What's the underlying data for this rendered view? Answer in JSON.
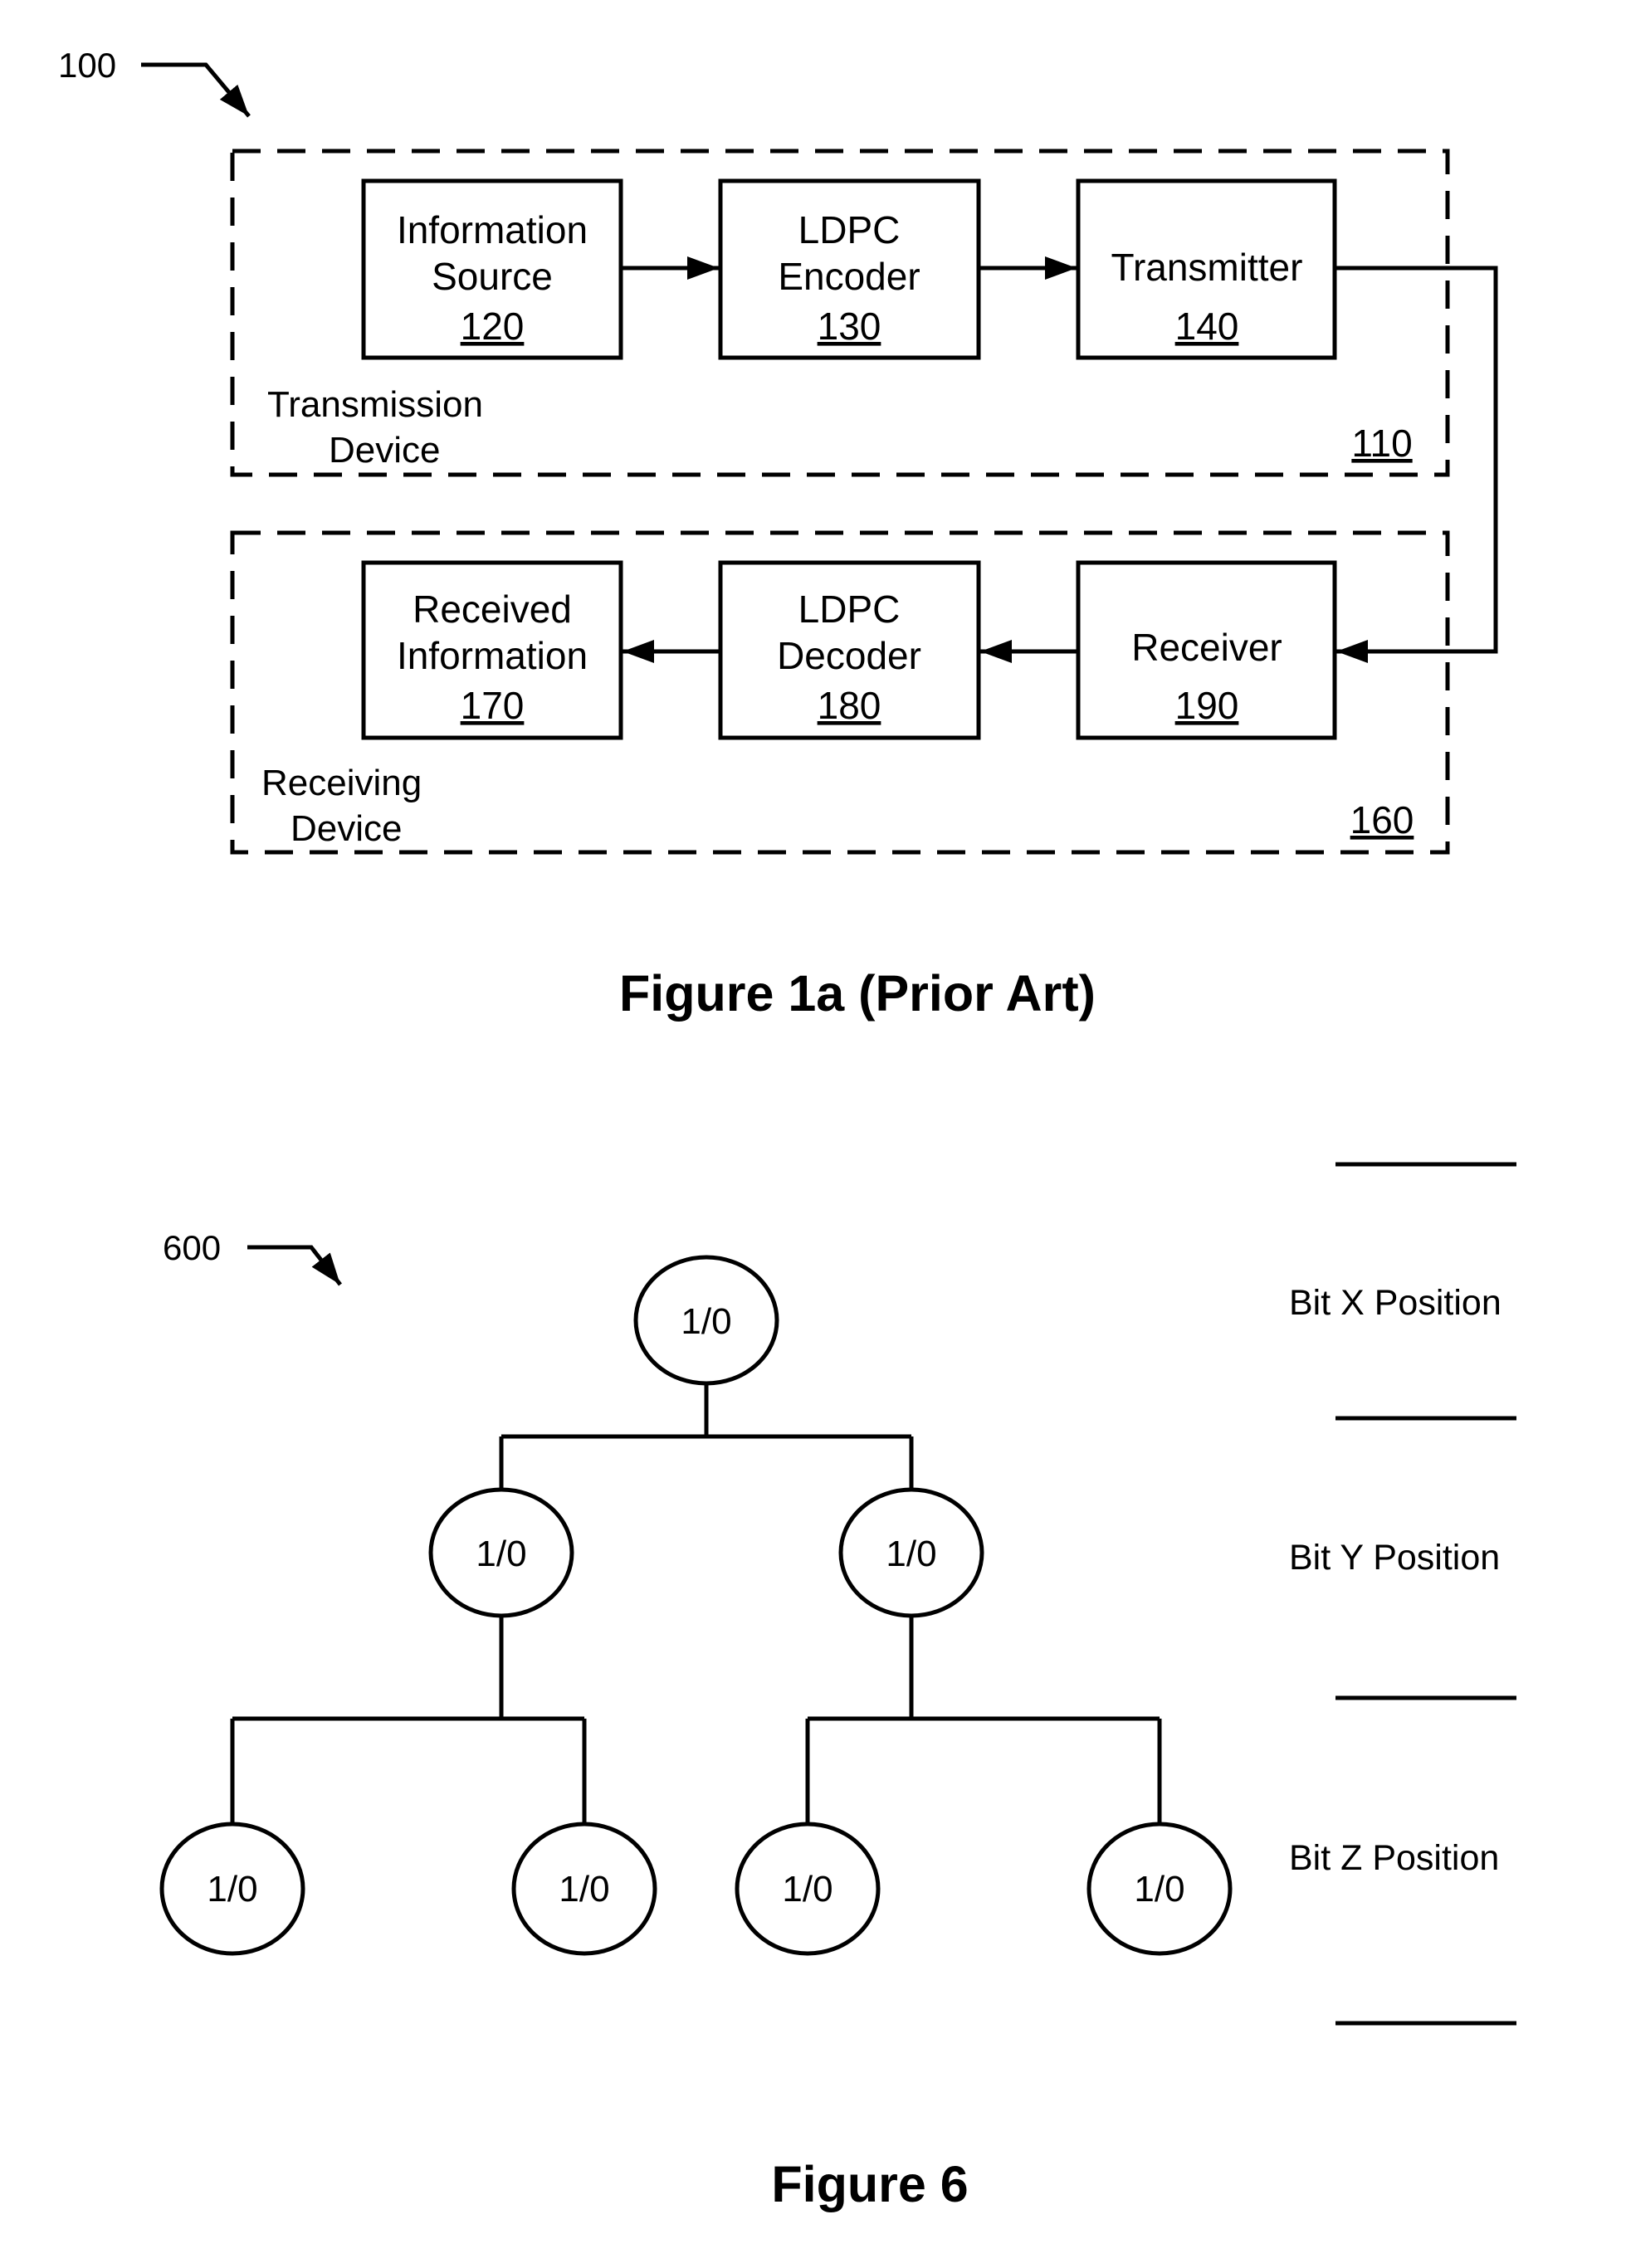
{
  "figure1a": {
    "reference": "100",
    "caption": "Figure 1a (Prior Art)",
    "transmission_device": {
      "label_line1": "Transmission",
      "label_line2": "Device",
      "number": "110",
      "blocks": [
        {
          "line1": "Information",
          "line2": "Source",
          "number": "120"
        },
        {
          "line1": "LDPC",
          "line2": "Encoder",
          "number": "130"
        },
        {
          "line1": "Transmitter",
          "line2": "",
          "number": "140"
        }
      ]
    },
    "receiving_device": {
      "label_line1": "Receiving",
      "label_line2": "Device",
      "number": "160",
      "blocks": [
        {
          "line1": "Received",
          "line2": "Information",
          "number": "170"
        },
        {
          "line1": "LDPC",
          "line2": "Decoder",
          "number": "180"
        },
        {
          "line1": "Receiver",
          "line2": "",
          "number": "190"
        }
      ]
    }
  },
  "figure6": {
    "reference": "600",
    "caption": "Figure 6",
    "nodes": {
      "root": "1/0",
      "level2": [
        "1/0",
        "1/0"
      ],
      "level3": [
        "1/0",
        "1/0",
        "1/0",
        "1/0"
      ]
    },
    "bit_positions": [
      "Bit X Position",
      "Bit Y Position",
      "Bit Z Position"
    ]
  }
}
